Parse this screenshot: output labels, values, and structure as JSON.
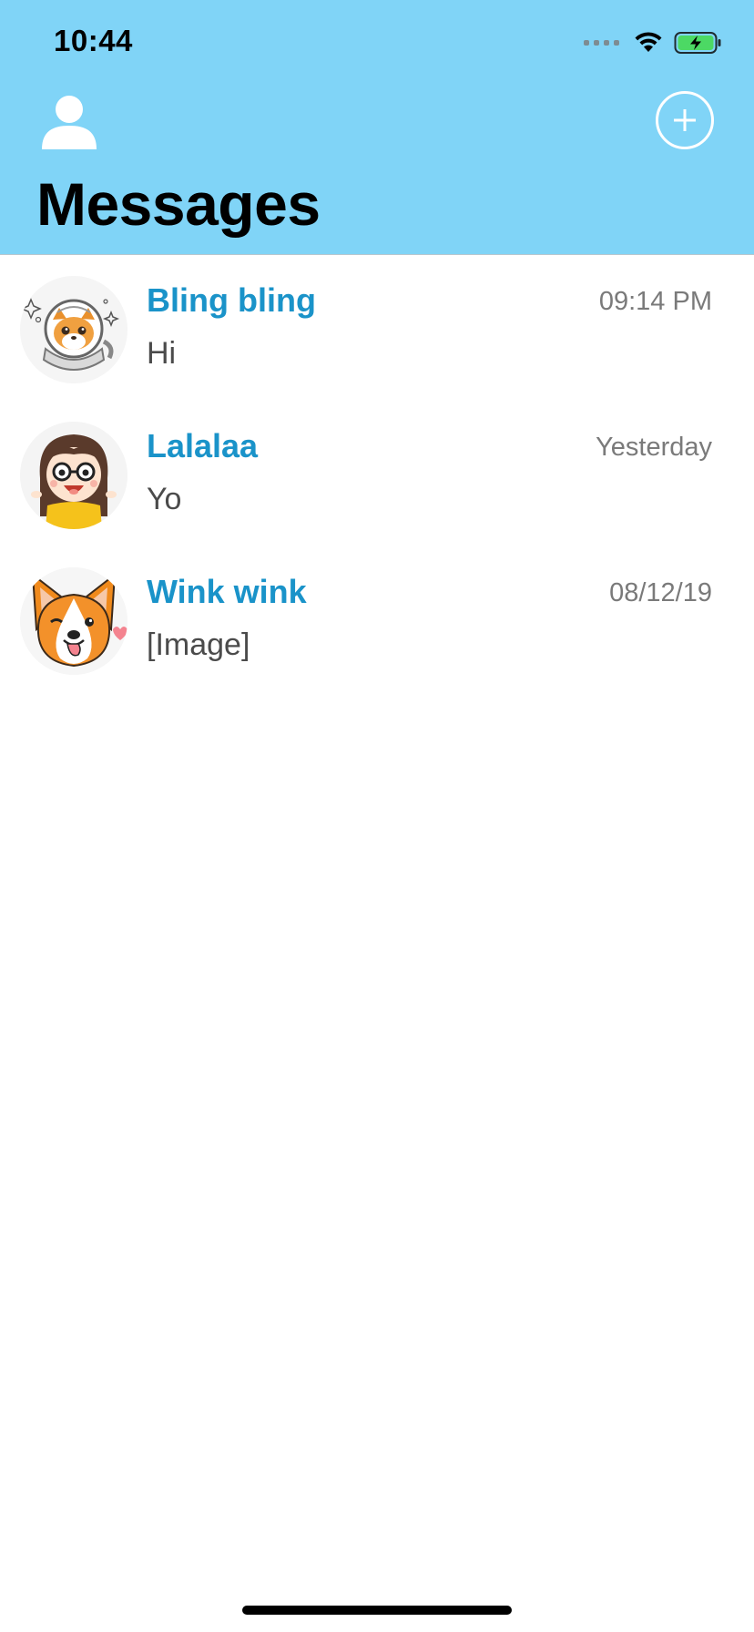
{
  "status_bar": {
    "time": "10:44",
    "wifi_icon": "wifi-icon",
    "battery_icon": "battery-charging-icon"
  },
  "header": {
    "title": "Messages",
    "profile_icon": "person-icon",
    "add_icon": "plus-circle-icon",
    "background_color": "#80d4f7"
  },
  "conversations": [
    {
      "name": "Bling bling",
      "preview": "Hi",
      "time": "09:14 PM",
      "avatar_icon": "shiba-astronaut-sticker"
    },
    {
      "name": "Lalalaa",
      "preview": "Yo",
      "time": "Yesterday",
      "avatar_icon": "girl-with-glasses-sticker"
    },
    {
      "name": "Wink wink",
      "preview": "[Image]",
      "time": "08/12/19",
      "avatar_icon": "corgi-wink-sticker"
    }
  ],
  "colors": {
    "name": "#1a93c9",
    "preview": "#4b4b4b",
    "time": "#7a7a7a"
  }
}
